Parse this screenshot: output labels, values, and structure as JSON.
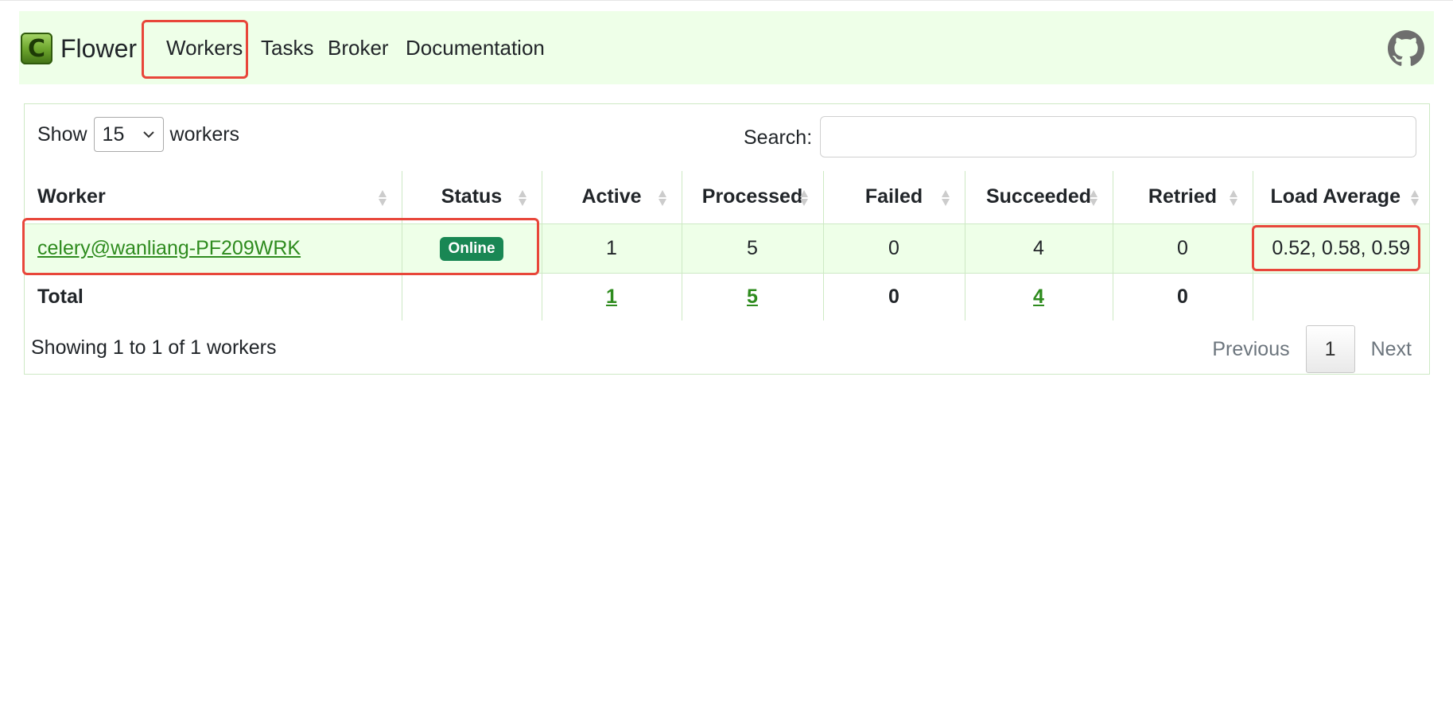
{
  "app": {
    "brand": "Flower"
  },
  "nav": {
    "workers": "Workers",
    "tasks": "Tasks",
    "broker": "Broker",
    "documentation": "Documentation"
  },
  "controls": {
    "show_label": "Show",
    "page_size": "15",
    "workers_label": "workers",
    "search_label": "Search:",
    "search_value": ""
  },
  "table": {
    "headers": [
      "Worker",
      "Status",
      "Active",
      "Processed",
      "Failed",
      "Succeeded",
      "Retried",
      "Load Average"
    ],
    "rows": [
      {
        "worker": "celery@wanliang-PF209WRK",
        "status": "Online",
        "active": "1",
        "processed": "5",
        "failed": "0",
        "succeeded": "4",
        "retried": "0",
        "load_average": "0.52, 0.58, 0.59"
      }
    ],
    "total": {
      "label": "Total",
      "active": "1",
      "processed": "5",
      "failed": "0",
      "succeeded": "4",
      "retried": "0"
    }
  },
  "footer": {
    "showing": "Showing 1 to 1 of 1 workers",
    "previous": "Previous",
    "page": "1",
    "next": "Next"
  },
  "colors": {
    "nav_bg": "#eeffe8",
    "link": "#2e8b1e",
    "badge": "#198754",
    "highlight": "#e8463a"
  }
}
